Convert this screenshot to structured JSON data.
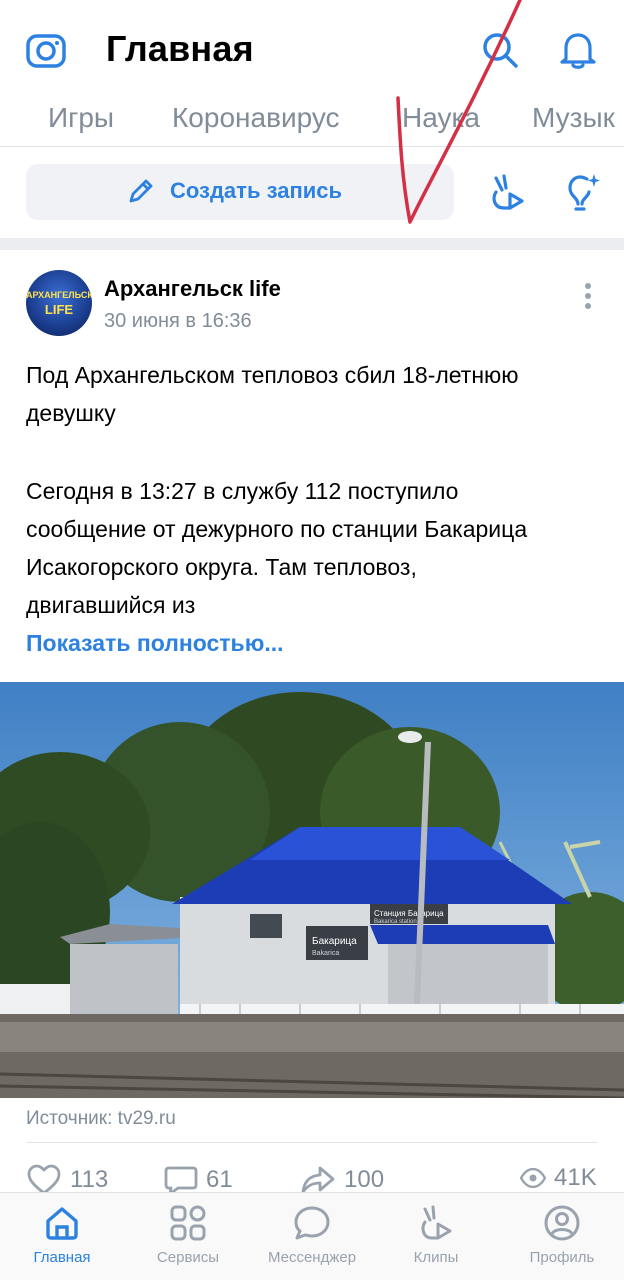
{
  "header": {
    "title": "Главная"
  },
  "tabs": [
    "Игры",
    "Коронавирус",
    "Наука",
    "Музык"
  ],
  "create": {
    "label": "Создать запись"
  },
  "post": {
    "author": "Архангельск life",
    "avatar_text_top": "АРХАНГЕЛЬСК",
    "avatar_text_bottom": "LIFE",
    "date": "30 июня в 16:36",
    "headline_line1": "Под Архангельском тепловоз сбил 18-летнюю",
    "headline_line2": "девушку",
    "body_line1": "Сегодня в 13:27 в службу 112 поступило",
    "body_line2": "сообщение от дежурного по станции Бакарица",
    "body_line3": "Исакогорского округа. Там тепловоз,",
    "body_line4": "двигавшийся из",
    "show_more": "Показать полностью...",
    "photo_sign_left": "Бакарица",
    "photo_sign_left_sub": "Bakarica",
    "photo_sign_right": "Станция Бакарица",
    "photo_sign_right_sub": "Bakarica station",
    "source": "Источник: tv29.ru"
  },
  "stats": {
    "likes": "113",
    "comments": "61",
    "shares": "100",
    "views": "41K"
  },
  "nav": {
    "home": "Главная",
    "services": "Сервисы",
    "messenger": "Мессенджер",
    "clips": "Клипы",
    "profile": "Профиль"
  },
  "colors": {
    "accent": "#2d81e0",
    "secondary_text": "#818c99",
    "annotation": "#d32f45"
  }
}
